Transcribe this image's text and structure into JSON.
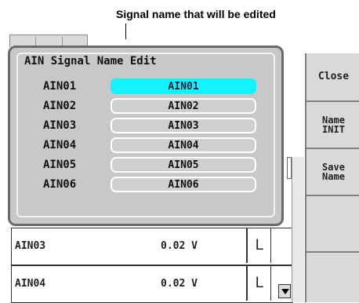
{
  "annotation": {
    "text": "Signal name that will be edited"
  },
  "dialog": {
    "title": "AIN Signal Name Edit",
    "signals": [
      {
        "label": "AIN01",
        "value": "AIN01",
        "selected": true
      },
      {
        "label": "AIN02",
        "value": "AIN02",
        "selected": false
      },
      {
        "label": "AIN03",
        "value": "AIN03",
        "selected": false
      },
      {
        "label": "AIN04",
        "value": "AIN04",
        "selected": false
      },
      {
        "label": "AIN05",
        "value": "AIN05",
        "selected": false
      },
      {
        "label": "AIN06",
        "value": "AIN06",
        "selected": false
      }
    ]
  },
  "softkeys": {
    "close": "Close",
    "name_init_line1": "Name",
    "name_init_line2": "INIT",
    "save_name_line1": "Save",
    "save_name_line2": "Name"
  },
  "data_rows": [
    {
      "name": "AIN03",
      "value": "0.02 V",
      "flag": "L"
    },
    {
      "name": "AIN04",
      "value": "0.02 V",
      "flag": "L"
    }
  ],
  "colors": {
    "selected_field": "#12f2ff",
    "dialog_bg": "#c8c8c8",
    "softkey_bg": "#d9d9d9"
  }
}
